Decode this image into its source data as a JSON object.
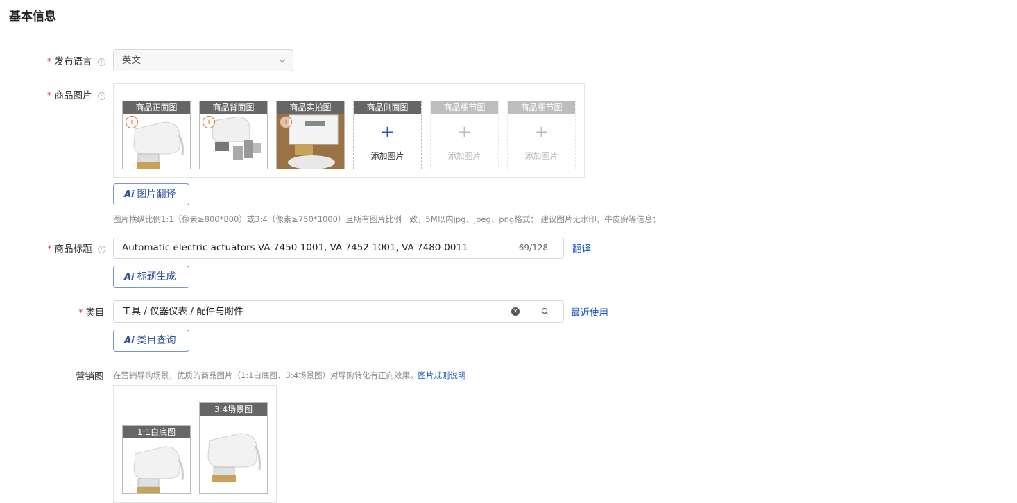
{
  "section": {
    "title": "基本信息"
  },
  "language": {
    "label": "发布语言",
    "value": "英文"
  },
  "images": {
    "label": "商品图片",
    "slots": [
      {
        "caption": "商品正面图",
        "state": "filled"
      },
      {
        "caption": "商品背面图",
        "state": "filled"
      },
      {
        "caption": "商品实拍图",
        "state": "filled"
      },
      {
        "caption": "商品侧面图",
        "state": "empty",
        "add_text": "添加图片"
      },
      {
        "caption": "商品细节图",
        "state": "disabled",
        "add_text": "添加图片"
      },
      {
        "caption": "商品细节图",
        "state": "disabled",
        "add_text": "添加图片"
      }
    ],
    "ai_button": "图片翻译",
    "hint": "图片横纵比例1:1（像素≥800*800）或3:4（像素≥750*1000）且所有图片比例一致，5M以内jpg、jpeg、png格式； 建议图片无水印、牛皮癣等信息；"
  },
  "title": {
    "label": "商品标题",
    "value": "Automatic electric actuators VA-7450 1001, VA 7452 1001, VA 7480-0011",
    "counter": "69/128",
    "translate_link": "翻译",
    "ai_button": "标题生成"
  },
  "category": {
    "label": "类目",
    "value": "工具 / 仪器仪表 / 配件与附件",
    "recent_link": "最近使用",
    "ai_button": "类目查询"
  },
  "marketing": {
    "label": "营销图",
    "hint": "在营销导购场景，优质的商品图片（1:1白底图、3:4场景图）对导购转化有正向效果。",
    "hint_link": "图片规则说明",
    "slots": [
      {
        "caption": "1:1白底图"
      },
      {
        "caption": "3:4场景图"
      }
    ]
  },
  "colors": {
    "accent": "#1a56c8",
    "required": "#e4393c",
    "warning": "#e86b2c"
  }
}
